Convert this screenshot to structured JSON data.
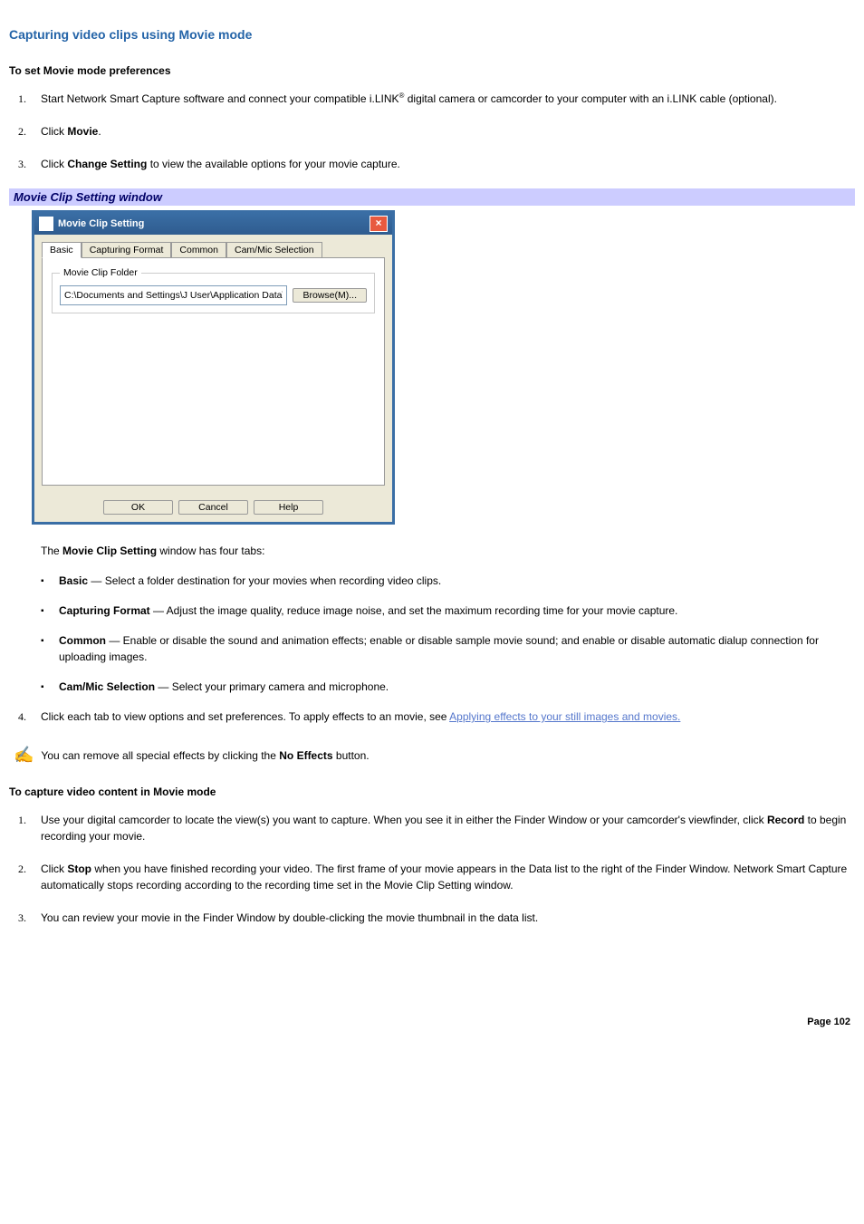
{
  "title": "Capturing video clips using Movie mode",
  "section1": {
    "heading": "To set Movie mode preferences",
    "steps": [
      {
        "num": "1.",
        "pre": "Start Network Smart Capture software and connect your compatible i.LINK",
        "reg": "®",
        "post": " digital camera or camcorder to your computer with an i.LINK cable (optional)."
      },
      {
        "num": "2.",
        "pre": "Click ",
        "bold": "Movie",
        "post": "."
      },
      {
        "num": "3.",
        "pre": "Click ",
        "bold": "Change Setting",
        "post": " to view the available options for your movie capture."
      }
    ]
  },
  "caption": "Movie Clip Setting window",
  "dialog": {
    "title": "Movie Clip Setting",
    "tabs": [
      "Basic",
      "Capturing Format",
      "Common",
      "Cam/Mic Selection"
    ],
    "group_label": "Movie Clip Folder",
    "folder_path": "C:\\Documents and Settings\\J User\\Application Data\\So",
    "browse": "Browse(M)...",
    "ok": "OK",
    "cancel": "Cancel",
    "help": "Help"
  },
  "para_after_dialog": {
    "pre": "The ",
    "bold": "Movie Clip Setting",
    "post": " window has four tabs:"
  },
  "tabs_desc": [
    {
      "bold": "Basic",
      "text": " — Select a folder destination for your movies when recording video clips."
    },
    {
      "bold": "Capturing Format",
      "text": " — Adjust the image quality, reduce image noise, and set the maximum recording time for your movie capture."
    },
    {
      "bold": "Common",
      "text": " — Enable or disable the sound and animation effects; enable or disable sample movie sound; and enable or disable automatic dialup connection for uploading images."
    },
    {
      "bold": "Cam/Mic Selection",
      "text": " — Select your primary camera and microphone."
    }
  ],
  "step4": {
    "num": "4.",
    "pre": "Click each tab to view options and set preferences. To apply effects to an movie, see ",
    "link": "Applying effects to your still images and movies."
  },
  "note": {
    "pre": "You can remove all special effects by clicking the ",
    "bold": "No Effects",
    "post": " button."
  },
  "section2": {
    "heading": "To capture video content in Movie mode",
    "steps": [
      {
        "num": "1.",
        "text_pre": "Use your digital camcorder to locate the view(s) you want to capture. When you see it in either the Finder Window or your camcorder's viewfinder, click ",
        "bold": "Record",
        "text_post": " to begin recording your movie."
      },
      {
        "num": "2.",
        "text_pre": "Click ",
        "bold": "Stop",
        "text_post": " when you have finished recording your video. The first frame of your movie appears in the Data list to the right of the Finder Window. Network Smart Capture automatically stops recording according to the recording time set in the Movie Clip Setting window."
      },
      {
        "num": "3.",
        "text_pre": "You can review your movie in the Finder Window by double-clicking the movie thumbnail in the data list.",
        "bold": "",
        "text_post": ""
      }
    ]
  },
  "page_number": "Page 102"
}
